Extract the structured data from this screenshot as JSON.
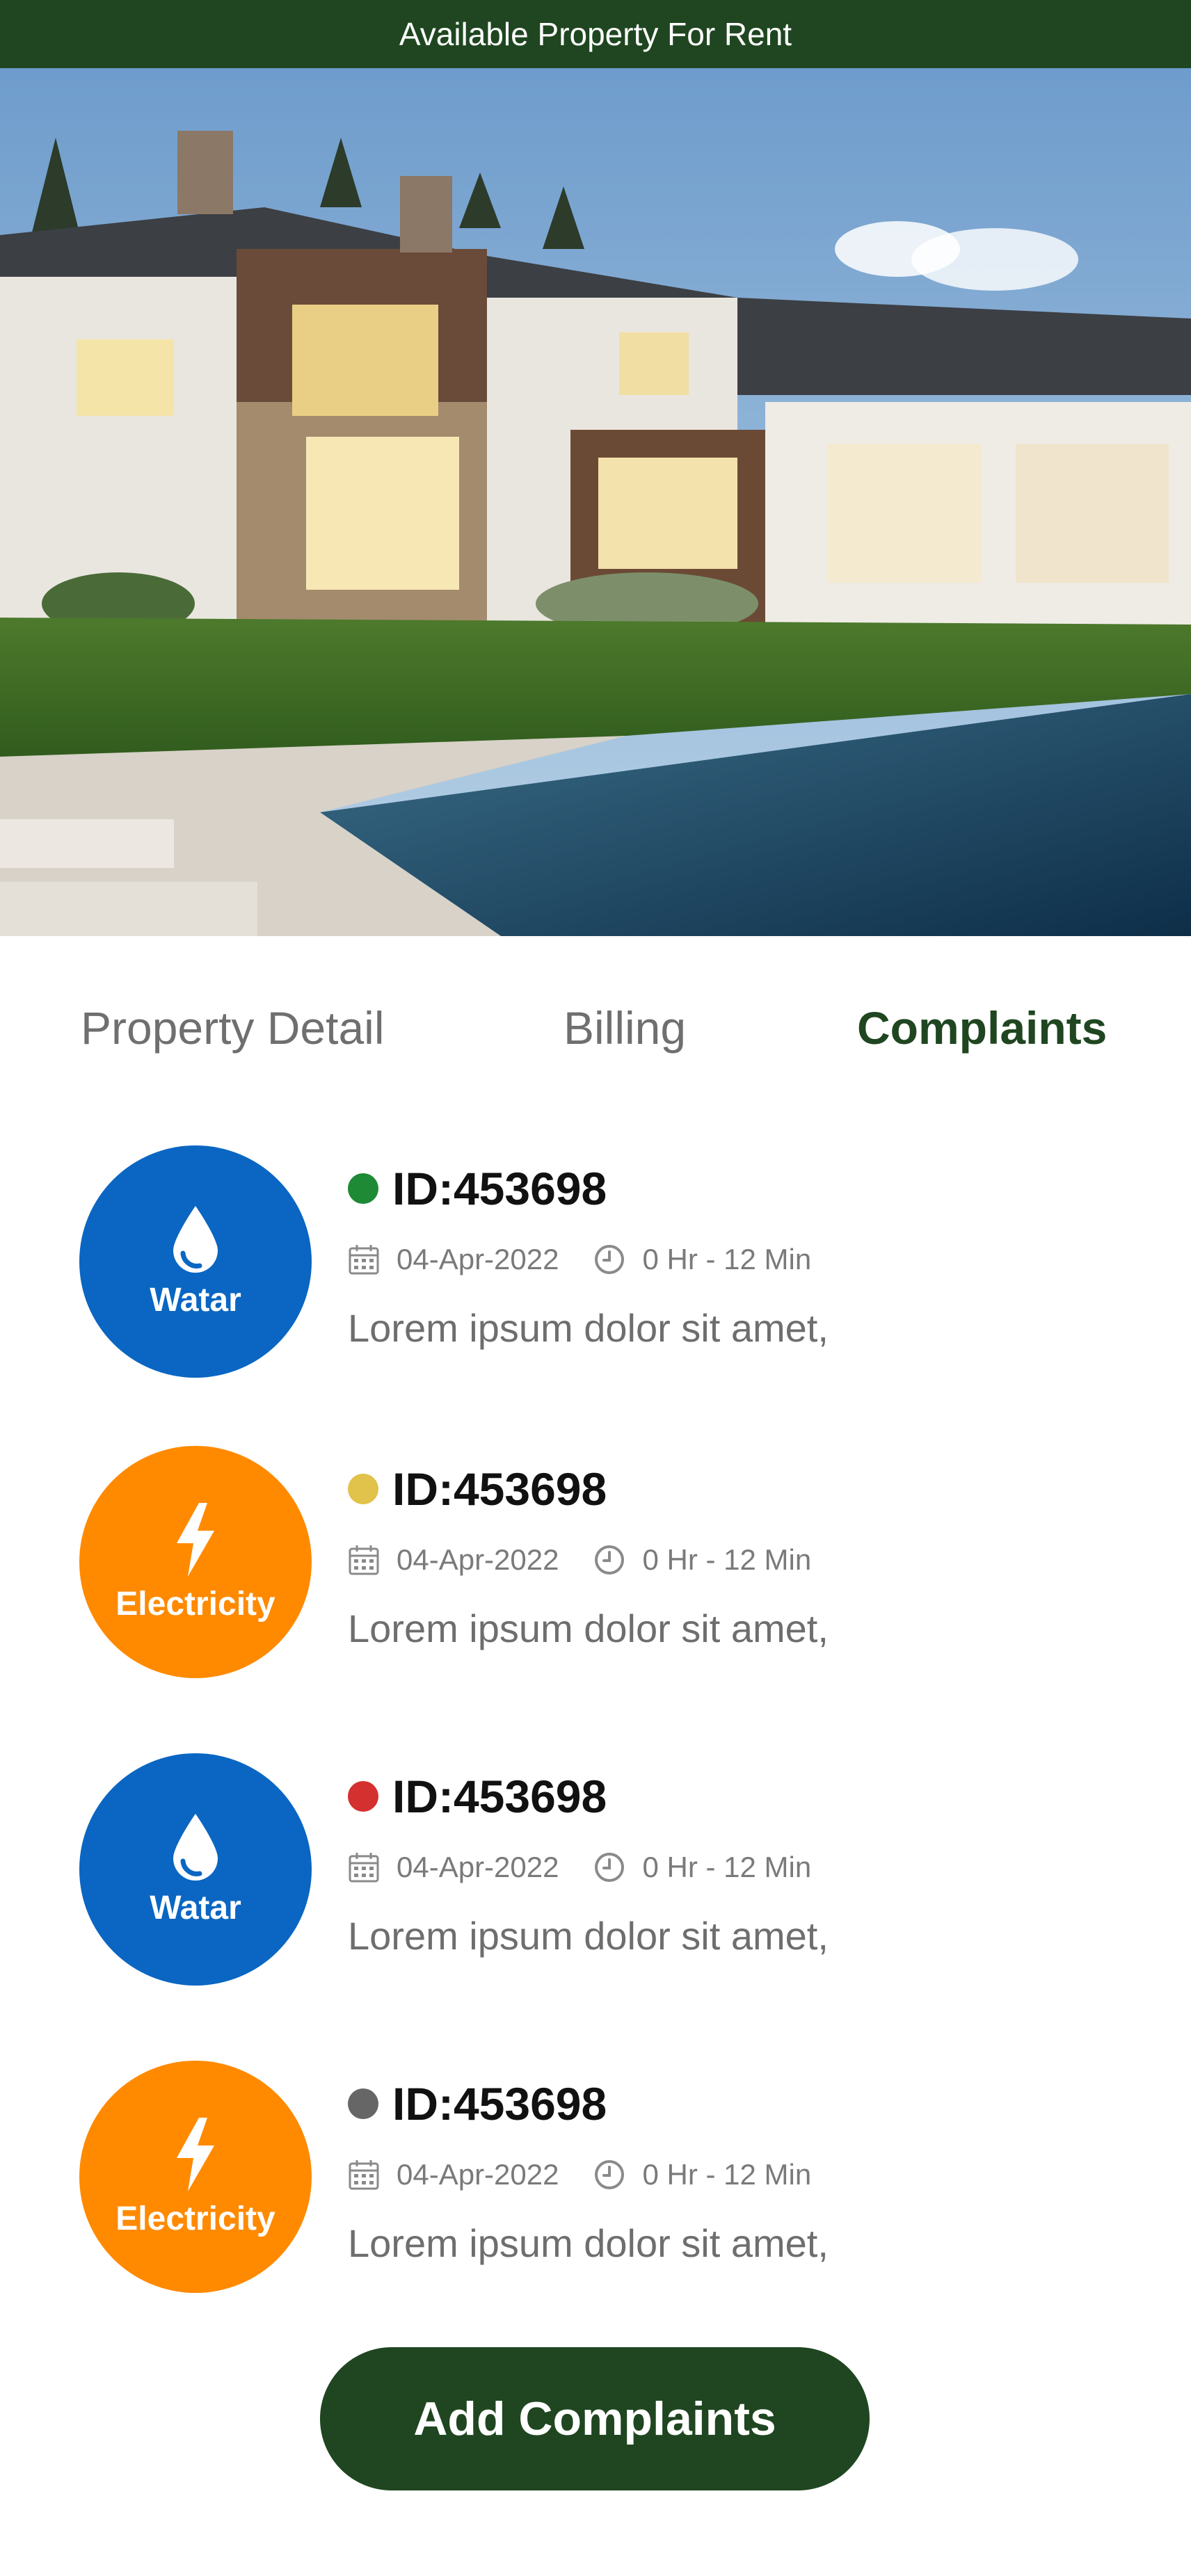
{
  "header": {
    "title": "Available Property For Rent"
  },
  "tabs": [
    {
      "label": "Property Detail",
      "active": false
    },
    {
      "label": "Billing",
      "active": false
    },
    {
      "label": "Complaints",
      "active": true
    }
  ],
  "complaints": [
    {
      "category": "Watar",
      "icon": "water-drop-icon",
      "status_color": "#1e8a35",
      "id": "ID:453698",
      "date": "04-Apr-2022",
      "duration": "0 Hr - 12 Min",
      "description": "Lorem ipsum dolor sit amet,"
    },
    {
      "category": "Electricity",
      "icon": "lightning-bolt-icon",
      "status_color": "#e1c24a",
      "id": "ID:453698",
      "date": "04-Apr-2022",
      "duration": "0 Hr - 12 Min",
      "description": "Lorem ipsum dolor sit amet,"
    },
    {
      "category": "Watar",
      "icon": "water-drop-icon",
      "status_color": "#d4302f",
      "id": "ID:453698",
      "date": "04-Apr-2022",
      "duration": "0 Hr - 12 Min",
      "description": "Lorem ipsum dolor sit amet,"
    },
    {
      "category": "Electricity",
      "icon": "lightning-bolt-icon",
      "status_color": "#666666",
      "id": "ID:453698",
      "date": "04-Apr-2022",
      "duration": "0 Hr - 12 Min",
      "description": "Lorem ipsum dolor sit amet,"
    }
  ],
  "actions": {
    "add_label": "Add Complaints"
  },
  "colors": {
    "primary": "#1f4620",
    "water": "#0a66c2",
    "electricity": "#ff8a00"
  }
}
